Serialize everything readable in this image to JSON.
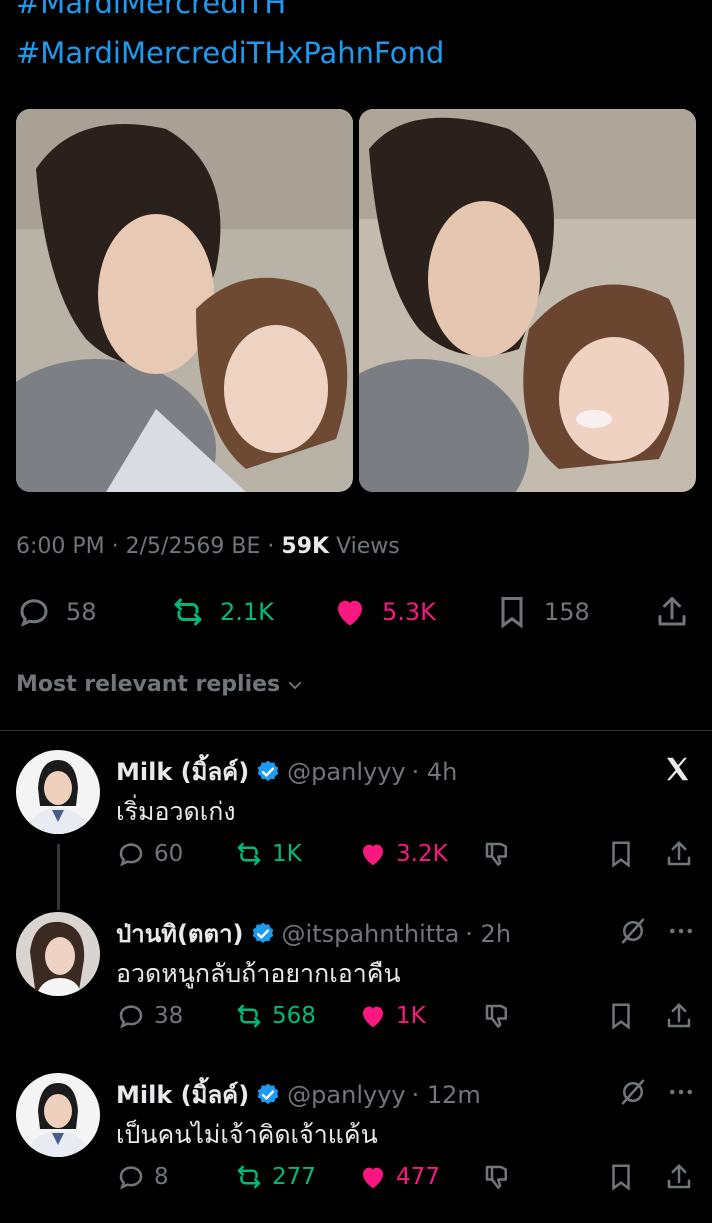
{
  "tweet": {
    "hashtags": [
      "#MardiMercrediTH",
      "#MardiMercrediTHxPahnFond"
    ],
    "time": "6:00 PM · 2/5/2569 BE · ",
    "views_count": "59K",
    "views_label": " Views",
    "stats": {
      "replies": "58",
      "retweets": "2.1K",
      "likes": "5.3K",
      "bookmarks": "158"
    }
  },
  "replies_filter": "Most relevant replies",
  "replies": [
    {
      "name": "Milk (มิ้ลค์)",
      "handle": "@panlyyy",
      "time": "· 4h",
      "text": "เริ่มอวดเก่ง",
      "replies": "60",
      "retweets": "1K",
      "likes": "3.2K",
      "corner_icon": "x-logo-icon"
    },
    {
      "name": "ป่านทิ(ตตา)",
      "handle": "@itspahnthitta",
      "time": "· 2h",
      "text": "อวดหนูกลับถ้าอยากเอาคืน",
      "replies": "38",
      "retweets": "568",
      "likes": "1K",
      "corner_icon": "grok-icon"
    },
    {
      "name": "Milk (มิ้ลค์)",
      "handle": "@panlyyy",
      "time": "· 12m",
      "text": "เป็นคนไม่เจ้าคิดเจ้าแค้น",
      "replies": "8",
      "retweets": "277",
      "likes": "477",
      "corner_icon": "grok-icon"
    }
  ],
  "colors": {
    "accent": "#1d9bf0",
    "retweet": "#00ba7c",
    "like": "#f91880",
    "muted": "#71767b",
    "background": "#000000"
  }
}
